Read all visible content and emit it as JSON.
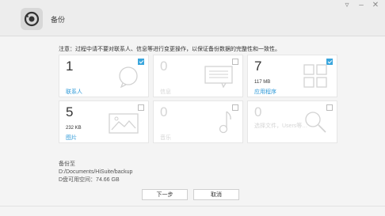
{
  "window": {
    "title": "备份",
    "controls": [
      "restore-down-icon",
      "minimize-icon",
      "close-icon"
    ]
  },
  "notice": "注意：过程中请不要对联系人、信息等进行变更操作，以保证备份数据的完整性和一致性。",
  "cards": [
    {
      "count": "1",
      "size": "",
      "label": "联系人",
      "checked": true,
      "enabled": true,
      "icon": "contacts-icon"
    },
    {
      "count": "0",
      "size": "",
      "label": "信息",
      "checked": false,
      "enabled": false,
      "icon": "messages-icon"
    },
    {
      "count": "7",
      "size": "117 MB",
      "label": "应用程序",
      "checked": true,
      "enabled": true,
      "icon": "apps-icon"
    },
    {
      "count": "5",
      "size": "232 KB",
      "label": "图片",
      "checked": false,
      "enabled": true,
      "icon": "pictures-icon"
    },
    {
      "count": "0",
      "size": "",
      "label": "音乐",
      "checked": false,
      "enabled": false,
      "icon": "music-icon"
    },
    {
      "count": "0",
      "size": "",
      "label": "选择文件，Users等…",
      "checked": false,
      "enabled": false,
      "icon": "search-files-icon"
    }
  ],
  "destination": {
    "title": "备份至",
    "path": "D:/Documents/HiSuite/backup",
    "free_space": "D盘可用空间：74.66 GB"
  },
  "buttons": {
    "next": "下一步",
    "cancel": "取消"
  }
}
